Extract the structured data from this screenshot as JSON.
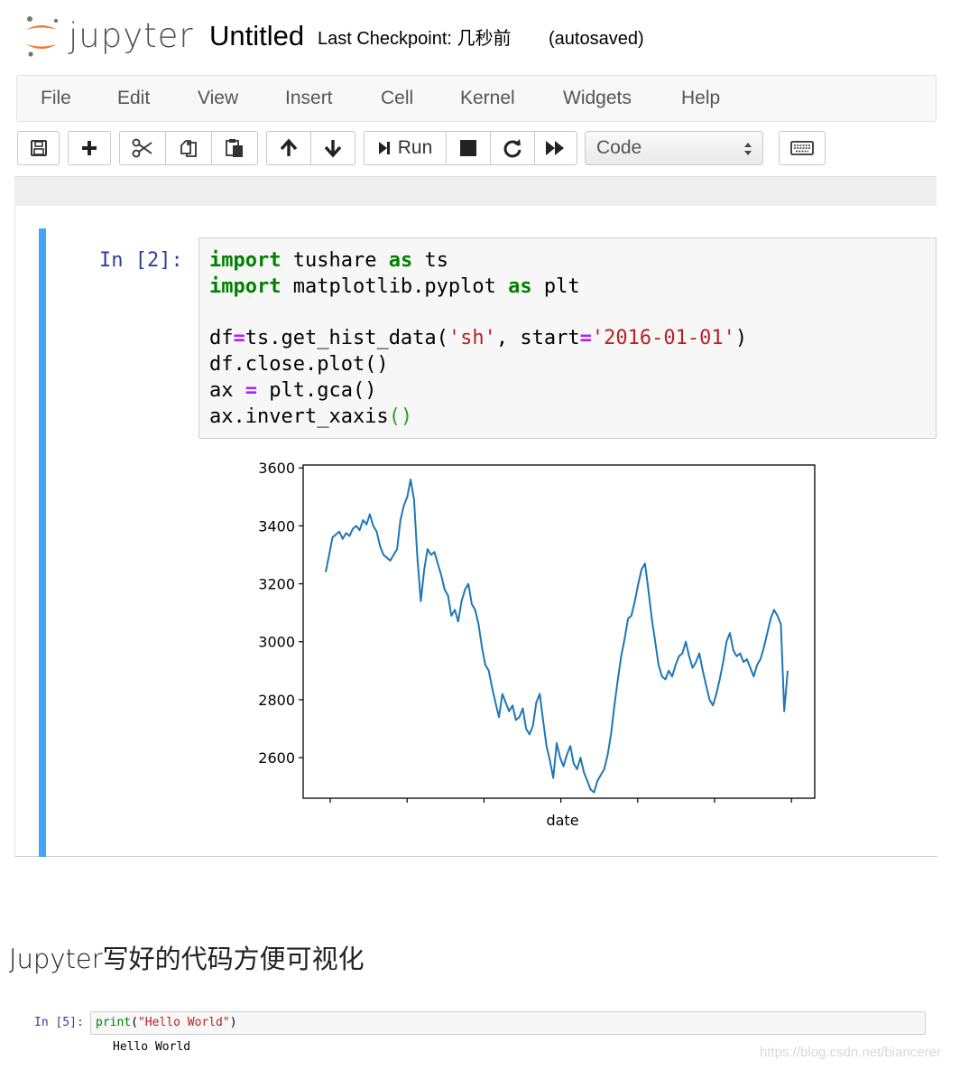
{
  "header": {
    "logo_text": "jupyter",
    "notebook_title": "Untitled",
    "checkpoint_text": "Last Checkpoint: 几秒前",
    "autosave_status": "(autosaved)"
  },
  "menubar": {
    "items": [
      "File",
      "Edit",
      "View",
      "Insert",
      "Cell",
      "Kernel",
      "Widgets",
      "Help"
    ]
  },
  "toolbar": {
    "run_label": "Run",
    "cell_type": "Code",
    "icons": [
      "save-icon",
      "plus-icon",
      "scissors-icon",
      "copy-icon",
      "paste-icon",
      "arrow-up-icon",
      "arrow-down-icon",
      "run-icon",
      "stop-icon",
      "restart-icon",
      "fast-forward-icon",
      "keyboard-icon"
    ]
  },
  "cell1": {
    "prompt": "In [2]:",
    "code_lines": [
      "import tushare as ts",
      "import matplotlib.pyplot as plt",
      "",
      "df=ts.get_hist_data('sh', start='2016-01-01')",
      "df.close.plot()",
      "ax = plt.gca()",
      "ax.invert_xaxis()"
    ]
  },
  "chart_data": {
    "type": "line",
    "title": "",
    "xlabel": "date",
    "ylabel": "",
    "ylim": [
      2460,
      3610
    ],
    "yticks": [
      2600,
      2800,
      3000,
      3200,
      3400,
      3600
    ],
    "ytick_labels": [
      "2600",
      "2800",
      "3000",
      "3200",
      "3400",
      "3600"
    ],
    "x_tick_count": 7,
    "x_tick_labels": [],
    "xaxis_inverted": true,
    "line_color": "#1f77b4",
    "series": [
      {
        "values": [
          3240,
          3300,
          3360,
          3370,
          3380,
          3355,
          3375,
          3365,
          3390,
          3400,
          3385,
          3420,
          3405,
          3440,
          3400,
          3380,
          3330,
          3300,
          3290,
          3280,
          3300,
          3320,
          3420,
          3470,
          3500,
          3560,
          3490,
          3290,
          3140,
          3250,
          3320,
          3300,
          3310,
          3270,
          3230,
          3180,
          3160,
          3090,
          3110,
          3070,
          3140,
          3180,
          3200,
          3130,
          3110,
          3060,
          2980,
          2920,
          2900,
          2840,
          2790,
          2740,
          2820,
          2790,
          2760,
          2780,
          2730,
          2740,
          2770,
          2700,
          2680,
          2710,
          2790,
          2820,
          2730,
          2640,
          2590,
          2530,
          2650,
          2600,
          2570,
          2610,
          2640,
          2580,
          2560,
          2600,
          2550,
          2520,
          2490,
          2480,
          2520,
          2540,
          2560,
          2610,
          2680,
          2780,
          2870,
          2950,
          3010,
          3080,
          3090,
          3140,
          3200,
          3250,
          3270,
          3180,
          3080,
          3000,
          2920,
          2880,
          2870,
          2900,
          2880,
          2920,
          2950,
          2960,
          3000,
          2950,
          2910,
          2930,
          2960,
          2900,
          2850,
          2800,
          2780,
          2820,
          2870,
          2930,
          3000,
          3030,
          2970,
          2950,
          2960,
          2930,
          2940,
          2910,
          2880,
          2920,
          2940,
          2980,
          3030,
          3080,
          3110,
          3090,
          3060,
          2760,
          2900
        ]
      }
    ]
  },
  "caption": {
    "text": "Jupyter写好的代码方便可视化"
  },
  "cell2": {
    "prompt": "In [5]:",
    "code_fn": "print",
    "code_open": "(",
    "code_str": "\"Hello World\"",
    "code_close": ")",
    "output": "Hello World"
  },
  "watermark": {
    "text": "https://blog.csdn.net/biancerer"
  }
}
